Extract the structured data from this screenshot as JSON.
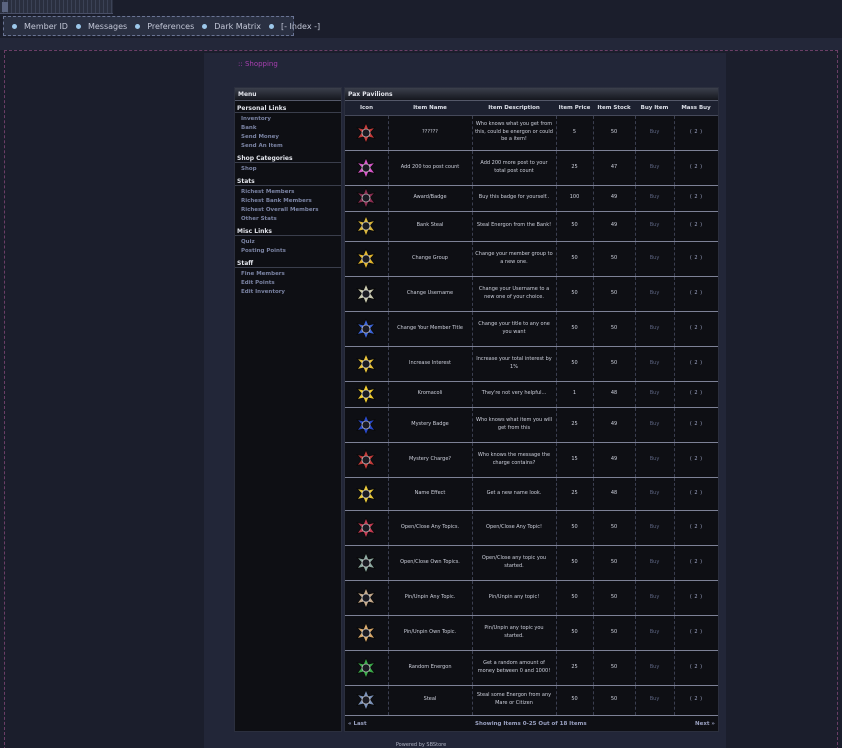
{
  "nav": [
    {
      "label": "Member ID"
    },
    {
      "label": "Messages"
    },
    {
      "label": "Preferences"
    },
    {
      "label": "Dark Matrix"
    },
    {
      "label": "[- Index -]"
    }
  ],
  "breadcrumb": ":: Shopping",
  "menu": {
    "title": "Menu",
    "sections": [
      {
        "title": "Personal Links",
        "links": [
          "Inventory",
          "Bank",
          "Send Money",
          "Send An Item"
        ]
      },
      {
        "title": "Shop Categories",
        "links": [
          "Shop"
        ]
      },
      {
        "title": "Stats",
        "links": [
          "Richest Members",
          "Richest Bank Members",
          "Richest Overall Members",
          "Other Stats"
        ]
      },
      {
        "title": "Misc Links",
        "links": [
          "Quiz",
          "Posting Points"
        ]
      },
      {
        "title": "Staff",
        "links": [
          "Fine Members",
          "Edit Points",
          "Edit Inventory"
        ]
      }
    ]
  },
  "shop": {
    "title": "Pax Pavilions",
    "columns": [
      "Icon",
      "Item Name",
      "Item Description",
      "Item Price",
      "Item Stock",
      "Buy Item",
      "Mass Buy"
    ],
    "items": [
      {
        "icon": "egg-icon",
        "color": "#c43a3a",
        "name": "??????",
        "desc": "Who knows what you get from this, could be energon or could be a item!",
        "price": "5",
        "stock": "50",
        "buy": "Buy",
        "mass": "( 2 )"
      },
      {
        "icon": "post-count-icon",
        "color": "#d455c8",
        "name": "Add 200 too post count",
        "desc": "Add 200 more post to your total post count",
        "price": "25",
        "stock": "47",
        "buy": "Buy",
        "mass": "( 2 )"
      },
      {
        "icon": "badge-icon",
        "color": "#8a2d52",
        "name": "Award/Badge",
        "desc": "Buy this badge for yourself..",
        "price": "100",
        "stock": "49",
        "buy": "Buy",
        "mass": "( 2 )"
      },
      {
        "icon": "bank-steal-icon",
        "color": "#d8b43a",
        "name": "Bank Steal",
        "desc": "Steal Energon from the Bank!",
        "price": "50",
        "stock": "49",
        "buy": "Buy",
        "mass": "( 2 )"
      },
      {
        "icon": "change-group-icon",
        "color": "#e2b52c",
        "name": "Change Group",
        "desc": "Change your member group to a new one.",
        "price": "50",
        "stock": "50",
        "buy": "Buy",
        "mass": "( 2 )"
      },
      {
        "icon": "change-username-icon",
        "color": "#c9c9b0",
        "name": "Change Username",
        "desc": "Change your Username to a new one of your choice.",
        "price": "50",
        "stock": "50",
        "buy": "Buy",
        "mass": "( 2 )"
      },
      {
        "icon": "member-title-icon",
        "color": "#3b63d8",
        "name": "Change Your Member Title",
        "desc": "Change your title to any one you want",
        "price": "50",
        "stock": "50",
        "buy": "Buy",
        "mass": "( 2 )"
      },
      {
        "icon": "interest-icon",
        "color": "#e8c23a",
        "name": "Increase Interest",
        "desc": "Increase your total interest by 1%",
        "price": "50",
        "stock": "50",
        "buy": "Buy",
        "mass": "( 2 )"
      },
      {
        "icon": "kromacoli-icon",
        "color": "#f0cb2e",
        "name": "Kromacoli",
        "desc": "They're not very helpful...",
        "price": "1",
        "stock": "48",
        "buy": "Buy",
        "mass": "( 2 )"
      },
      {
        "icon": "mystery-badge-icon",
        "color": "#2848c8",
        "name": "Mystery Badge",
        "desc": "Who knows what item you will get from this",
        "price": "25",
        "stock": "49",
        "buy": "Buy",
        "mass": "( 2 )"
      },
      {
        "icon": "mystery-charge-icon",
        "color": "#c23a3a",
        "name": "Mystery Charge?",
        "desc": "Who knows the message the charge contains?",
        "price": "15",
        "stock": "49",
        "buy": "Buy",
        "mass": "( 2 )"
      },
      {
        "icon": "name-effect-icon",
        "color": "#e8c83a",
        "name": "Name Effect",
        "desc": "Get a new name look.",
        "price": "25",
        "stock": "48",
        "buy": "Buy",
        "mass": "( 2 )"
      },
      {
        "icon": "open-close-any-icon",
        "color": "#c23a52",
        "name": "Open/Close Any Topics.",
        "desc": "Open/Close Any Topic!",
        "price": "50",
        "stock": "50",
        "buy": "Buy",
        "mass": "( 2 )"
      },
      {
        "icon": "open-close-own-icon",
        "color": "#8ca8a0",
        "name": "Open/Close Own Topics.",
        "desc": "Open/Close any topic you started.",
        "price": "50",
        "stock": "50",
        "buy": "Buy",
        "mass": "( 2 )"
      },
      {
        "icon": "pin-any-icon",
        "color": "#c4a88a",
        "name": "Pin/Unpin Any Topic.",
        "desc": "Pin/Unpin any topic!",
        "price": "50",
        "stock": "50",
        "buy": "Buy",
        "mass": "( 2 )"
      },
      {
        "icon": "pin-own-icon",
        "color": "#d8a86a",
        "name": "Pin/Unpin Own Topic.",
        "desc": "Pin/Unpin any topic you started.",
        "price": "50",
        "stock": "50",
        "buy": "Buy",
        "mass": "( 2 )"
      },
      {
        "icon": "random-energon-icon",
        "color": "#3aa84a",
        "name": "Random Energon",
        "desc": "Get a random amount of money between 0 and 1000!",
        "price": "25",
        "stock": "50",
        "buy": "Buy",
        "mass": "( 2 )"
      },
      {
        "icon": "steal-icon",
        "color": "#7a90b8",
        "name": "Steal",
        "desc": "Steal some Energon from any Mare or Citizen",
        "price": "50",
        "stock": "50",
        "buy": "Buy",
        "mass": "( 2 )"
      }
    ],
    "footer": {
      "prev": "« Last",
      "info": "Showing Items 0-25 Out of 18 Items",
      "next": "Next »"
    }
  },
  "powered": "Powered by SBStore"
}
